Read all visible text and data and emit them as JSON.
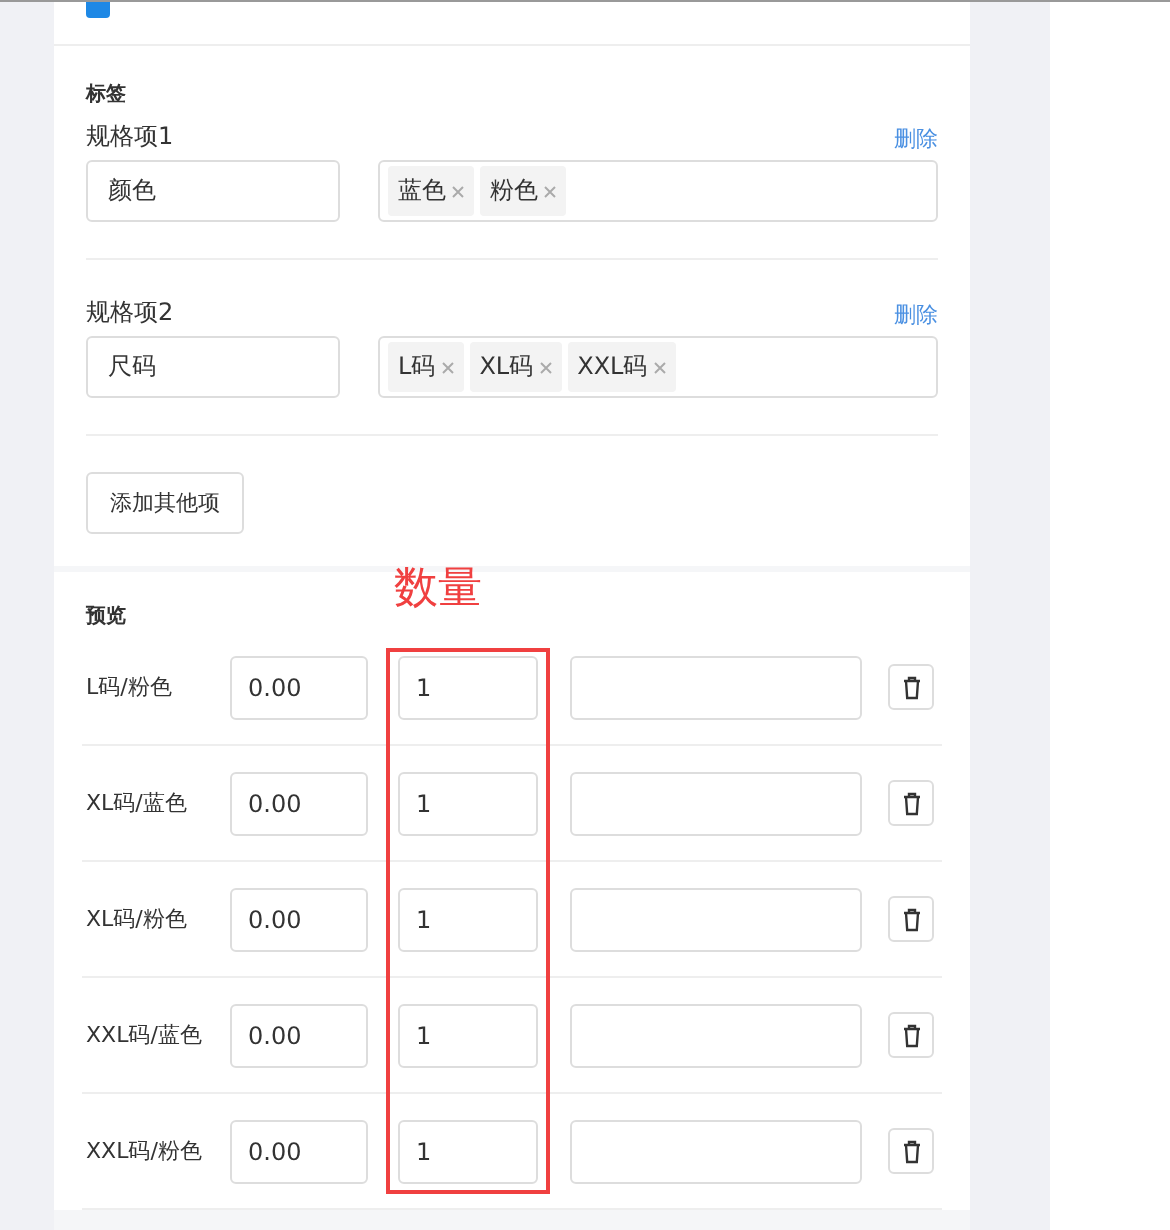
{
  "header": {
    "checkbox_checked": true
  },
  "tags_section": {
    "title": "标签",
    "specs": [
      {
        "label": "规格项1",
        "delete": "删除",
        "name": "颜色",
        "values": [
          "蓝色",
          "粉色"
        ]
      },
      {
        "label": "规格项2",
        "delete": "删除",
        "name": "尺码",
        "values": [
          "L码",
          "XL码",
          "XXL码"
        ]
      }
    ],
    "add_button": "添加其他项"
  },
  "preview": {
    "title": "预览",
    "annotation": "数量",
    "rows": [
      {
        "name": "L码/粉色",
        "price": "0.00",
        "quantity": "1"
      },
      {
        "name": "XL码/蓝色",
        "price": "0.00",
        "quantity": "1"
      },
      {
        "name": "XL码/粉色",
        "price": "0.00",
        "quantity": "1"
      },
      {
        "name": "XXL码/蓝色",
        "price": "0.00",
        "quantity": "1"
      },
      {
        "name": "XXL码/粉色",
        "price": "0.00",
        "quantity": "1"
      }
    ]
  }
}
